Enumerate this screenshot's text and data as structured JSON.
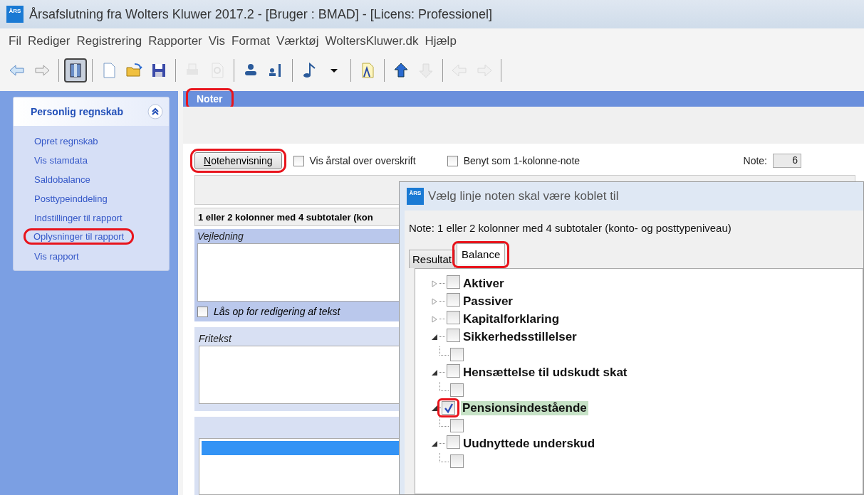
{
  "window": {
    "app_icon": "ÅRS",
    "title": "Årsafslutning fra Wolters Kluwer 2017.2 - [Bruger : BMAD] - [Licens: Professionel]"
  },
  "menu": [
    "Fil",
    "Rediger",
    "Registrering",
    "Rapporter",
    "Vis",
    "Format",
    "Værktøj",
    "WoltersKluwer.dk",
    "Hjælp"
  ],
  "toolbar": [
    [
      {
        "kind": "back",
        "disabled": false,
        "pressed": false
      },
      {
        "kind": "forward",
        "disabled": false,
        "pressed": false
      }
    ],
    [
      {
        "kind": "book",
        "disabled": false,
        "pressed": true
      }
    ],
    [
      {
        "kind": "new",
        "disabled": false,
        "pressed": false
      },
      {
        "kind": "open",
        "disabled": false,
        "pressed": false
      },
      {
        "kind": "save",
        "disabled": false,
        "pressed": false
      }
    ],
    [
      {
        "kind": "print",
        "disabled": true,
        "pressed": false
      },
      {
        "kind": "preview",
        "disabled": true,
        "pressed": false
      }
    ],
    [
      {
        "kind": "stamp",
        "disabled": false,
        "pressed": false
      },
      {
        "kind": "numbering",
        "disabled": false,
        "pressed": false
      }
    ],
    [
      {
        "kind": "note",
        "disabled": false,
        "pressed": false
      },
      {
        "kind": "dropdown",
        "disabled": false,
        "pressed": false
      }
    ],
    [
      {
        "kind": "year",
        "disabled": false,
        "pressed": false
      }
    ],
    [
      {
        "kind": "up",
        "disabled": false,
        "pressed": false
      },
      {
        "kind": "down",
        "disabled": true,
        "pressed": false
      }
    ],
    [
      {
        "kind": "left",
        "disabled": true,
        "pressed": false
      },
      {
        "kind": "right",
        "disabled": true,
        "pressed": false
      }
    ]
  ],
  "sidebar": {
    "title": "Personlig regnskab",
    "items": [
      {
        "label": "Opret regnskab",
        "circled": false
      },
      {
        "label": "Vis stamdata",
        "circled": false
      },
      {
        "label": "Saldobalance",
        "circled": false
      },
      {
        "label": "Posttypeinddeling",
        "circled": false
      },
      {
        "label": "Indstillinger til rapport",
        "circled": false
      },
      {
        "label": "Oplysninger til rapport",
        "circled": true
      },
      {
        "label": "Vis rapport",
        "circled": false
      }
    ]
  },
  "panel": {
    "title": "Noter",
    "circled": true,
    "note_ref_button": {
      "label": "Notehenvisning",
      "circled": true
    },
    "options": [
      {
        "label": "Vis årstal over overskrift",
        "checked": false
      },
      {
        "label": "Benyt som 1-kolonne-note",
        "checked": false
      }
    ],
    "note_label": "Note:",
    "note_number": "6",
    "note_type": "1 eller 2 kolonner med 4 subtotaler (kon",
    "guidance": {
      "title": "Vejledning",
      "unlock": {
        "label": "Lås op for redigering af tekst",
        "checked": false
      }
    },
    "free_text": {
      "title": "Fritekst"
    }
  },
  "dialog": {
    "app_icon": "ÅRS",
    "title": "Vælg linje noten skal være koblet til",
    "note": "Note: 1 eller 2 kolonner med 4 subtotaler (konto- og posttypeniveau)",
    "tabs": [
      {
        "label": "Resultat",
        "selected": false,
        "circled": false
      },
      {
        "label": "Balance",
        "selected": true,
        "circled": true
      }
    ],
    "tree": [
      {
        "label": "Aktiver",
        "checked": false,
        "expanded": false,
        "highlighted": false,
        "circled": false
      },
      {
        "label": "Passiver",
        "checked": false,
        "expanded": false,
        "highlighted": false,
        "circled": false
      },
      {
        "label": "Kapitalforklaring",
        "checked": false,
        "expanded": false,
        "highlighted": false,
        "circled": false
      },
      {
        "label": "Sikkerhedsstillelser",
        "checked": false,
        "expanded": true,
        "highlighted": false,
        "circled": false,
        "children": [
          {
            "checked": false
          }
        ]
      },
      {
        "label": "Hensættelse til udskudt skat",
        "checked": false,
        "expanded": true,
        "highlighted": false,
        "circled": false,
        "children": [
          {
            "checked": false
          }
        ]
      },
      {
        "label": "Pensionsindestående",
        "checked": true,
        "expanded": true,
        "highlighted": true,
        "circled": true,
        "children": [
          {
            "checked": false
          }
        ]
      },
      {
        "label": "Uudnyttede underskud",
        "checked": false,
        "expanded": true,
        "highlighted": false,
        "circled": false,
        "children": [
          {
            "checked": false
          }
        ]
      }
    ]
  }
}
